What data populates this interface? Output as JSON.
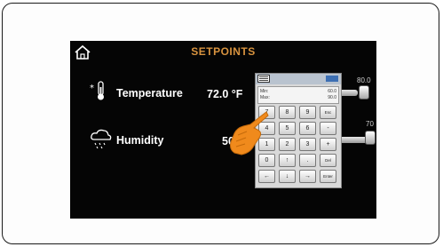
{
  "screen": {
    "title": "SETPOINTS",
    "home_icon": "home-icon"
  },
  "rows": [
    {
      "icon": "thermometer-snowflake-icon",
      "label": "Temperature",
      "value": "72.0 °F",
      "slider_value": "80.0"
    },
    {
      "icon": "humidity-cloud-icon",
      "label": "Humidity",
      "value": "50",
      "slider_value": "70"
    }
  ],
  "keypad": {
    "display": {
      "min_label": "Min:",
      "max_label": "Max:",
      "min_value": "60.0",
      "max_value": "90.0"
    },
    "keys": [
      "7",
      "8",
      "9",
      "Esc",
      "4",
      "5",
      "6",
      "-",
      "1",
      "2",
      "3",
      "+",
      "0",
      "↑",
      ".",
      "Del",
      "←",
      "↓",
      "→",
      "Enter"
    ]
  },
  "colors": {
    "title": "#d8933f",
    "screen_bg": "#050505",
    "hand": "#f08a1c"
  }
}
